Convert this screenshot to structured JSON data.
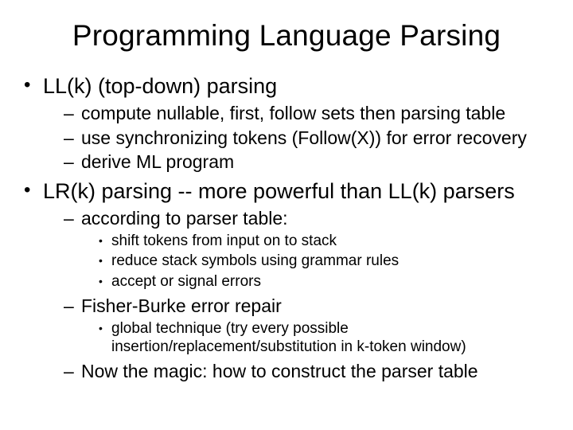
{
  "title": "Programming Language Parsing",
  "bullets": {
    "b0": {
      "text": "LL(k) (top-down) parsing",
      "sub": {
        "s0": "compute nullable, first, follow sets then parsing table",
        "s1": "use synchronizing tokens (Follow(X)) for error recovery",
        "s2": "derive ML program"
      }
    },
    "b1": {
      "text": "LR(k) parsing -- more powerful than LL(k) parsers",
      "sub": {
        "s0": {
          "text": "according to parser table:",
          "sub": {
            "t0": "shift tokens from input on to stack",
            "t1": "reduce stack symbols using grammar rules",
            "t2": "accept or signal errors"
          }
        },
        "s1": {
          "text": "Fisher-Burke error repair",
          "sub": {
            "t0": "global technique (try every possible insertion/replacement/substitution in k-token window)"
          }
        },
        "s2": {
          "text": "Now the magic:  how to construct the parser table"
        }
      }
    }
  }
}
